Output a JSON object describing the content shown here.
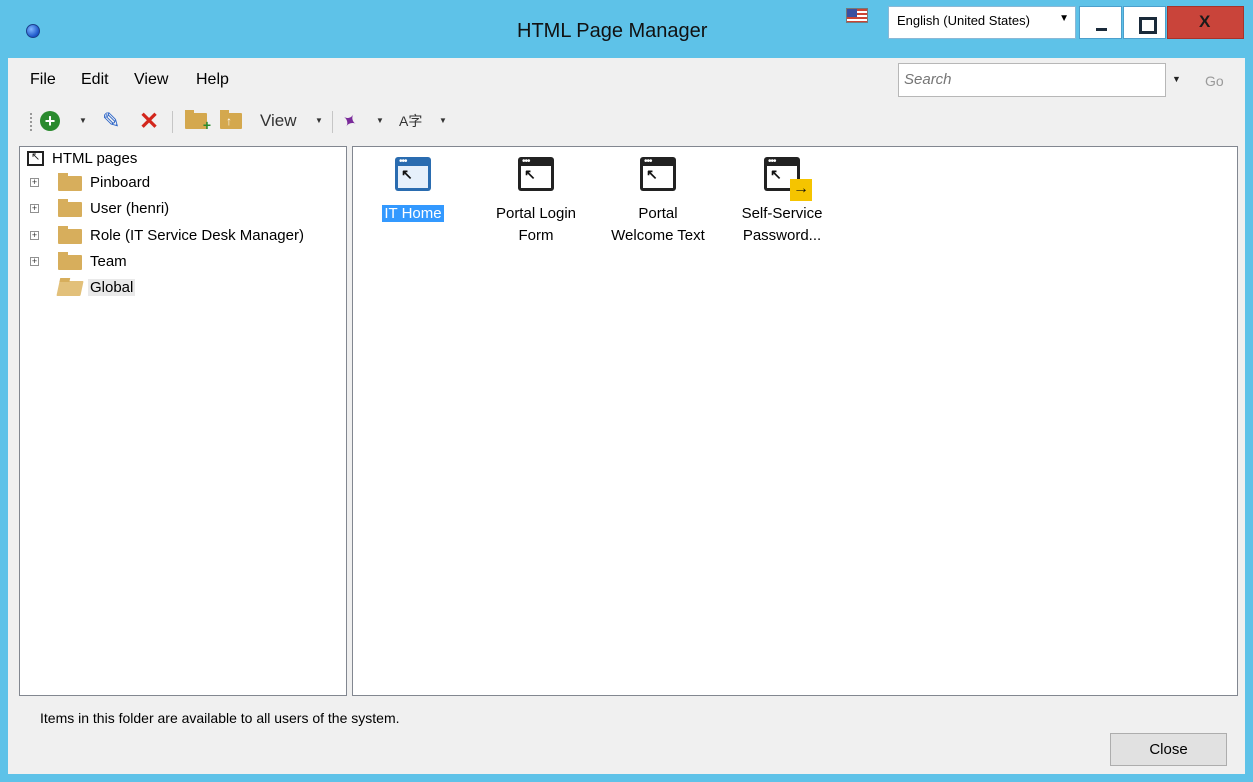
{
  "window": {
    "title": "HTML Page Manager",
    "language": "English (United States)"
  },
  "menu": {
    "file": "File",
    "edit": "Edit",
    "view": "View",
    "help": "Help"
  },
  "search": {
    "placeholder": "Search",
    "go_label": "Go"
  },
  "toolbar": {
    "view_label": "View",
    "lang_icon_text": "A字"
  },
  "tree": {
    "root": "HTML pages",
    "items": [
      {
        "label": "Pinboard",
        "expandable": true
      },
      {
        "label": "User (henri)",
        "expandable": true
      },
      {
        "label": "Role (IT Service Desk Manager)",
        "expandable": true
      },
      {
        "label": "Team",
        "expandable": true
      },
      {
        "label": "Global",
        "expandable": false,
        "selected": true
      }
    ]
  },
  "pages": [
    {
      "line1": "IT Home",
      "line2": "",
      "selected": true
    },
    {
      "line1": "Portal Login",
      "line2": "Form",
      "selected": false
    },
    {
      "line1": "Portal",
      "line2": "Welcome Text",
      "selected": false
    },
    {
      "line1": "Self-Service",
      "line2": "Password...",
      "selected": false
    }
  ],
  "status": {
    "text": "Items in this folder are available to all users of the system."
  },
  "buttons": {
    "close": "Close",
    "close_window": "X"
  },
  "icons": {
    "dropdown": "▾",
    "pencil": "✎",
    "delete": "✕",
    "add": "+",
    "pin": "📌",
    "arrow": "→"
  }
}
